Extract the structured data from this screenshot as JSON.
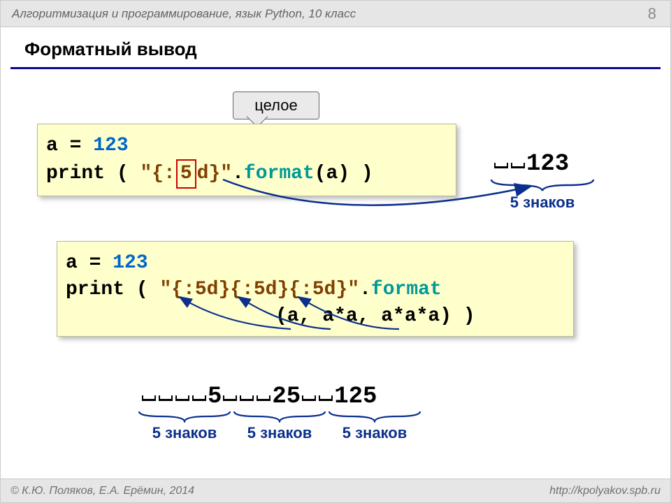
{
  "header": {
    "course": "Алгоритмизация и программирование, язык Python, 10 класс",
    "page": "8"
  },
  "title": "Форматный вывод",
  "callout": {
    "label": "целое"
  },
  "code1": {
    "l1_a": "a",
    "l1_eq": " = ",
    "l1_val": "123",
    "l2_print": "print",
    "l2_lpar": " ( ",
    "l2_str_open": "\"{:",
    "l2_five": "5",
    "l2_str_close": "d}\"",
    "l2_dot": ".",
    "l2_format": "format",
    "l2_args": "(a) )"
  },
  "out1": {
    "digits": "123",
    "label": "5 знаков"
  },
  "code2": {
    "l1_a": "a",
    "l1_eq": " = ",
    "l1_val": "123",
    "l2_print": "print",
    "l2_lpar": " ( ",
    "l2_str": "\"{:5d}{:5d}{:5d}\"",
    "l2_dot": ".",
    "l2_format": "format",
    "l3_args": "(a, a*a, a*a*a) )"
  },
  "out2": {
    "n1": "5",
    "n2": "25",
    "n3": "125",
    "label1": "5 знаков",
    "label2": "5 знаков",
    "label3": "5 знаков"
  },
  "footer": {
    "left": "© К.Ю. Поляков, Е.А. Ерёмин, 2014",
    "right": "http://kpolyakov.spb.ru"
  }
}
